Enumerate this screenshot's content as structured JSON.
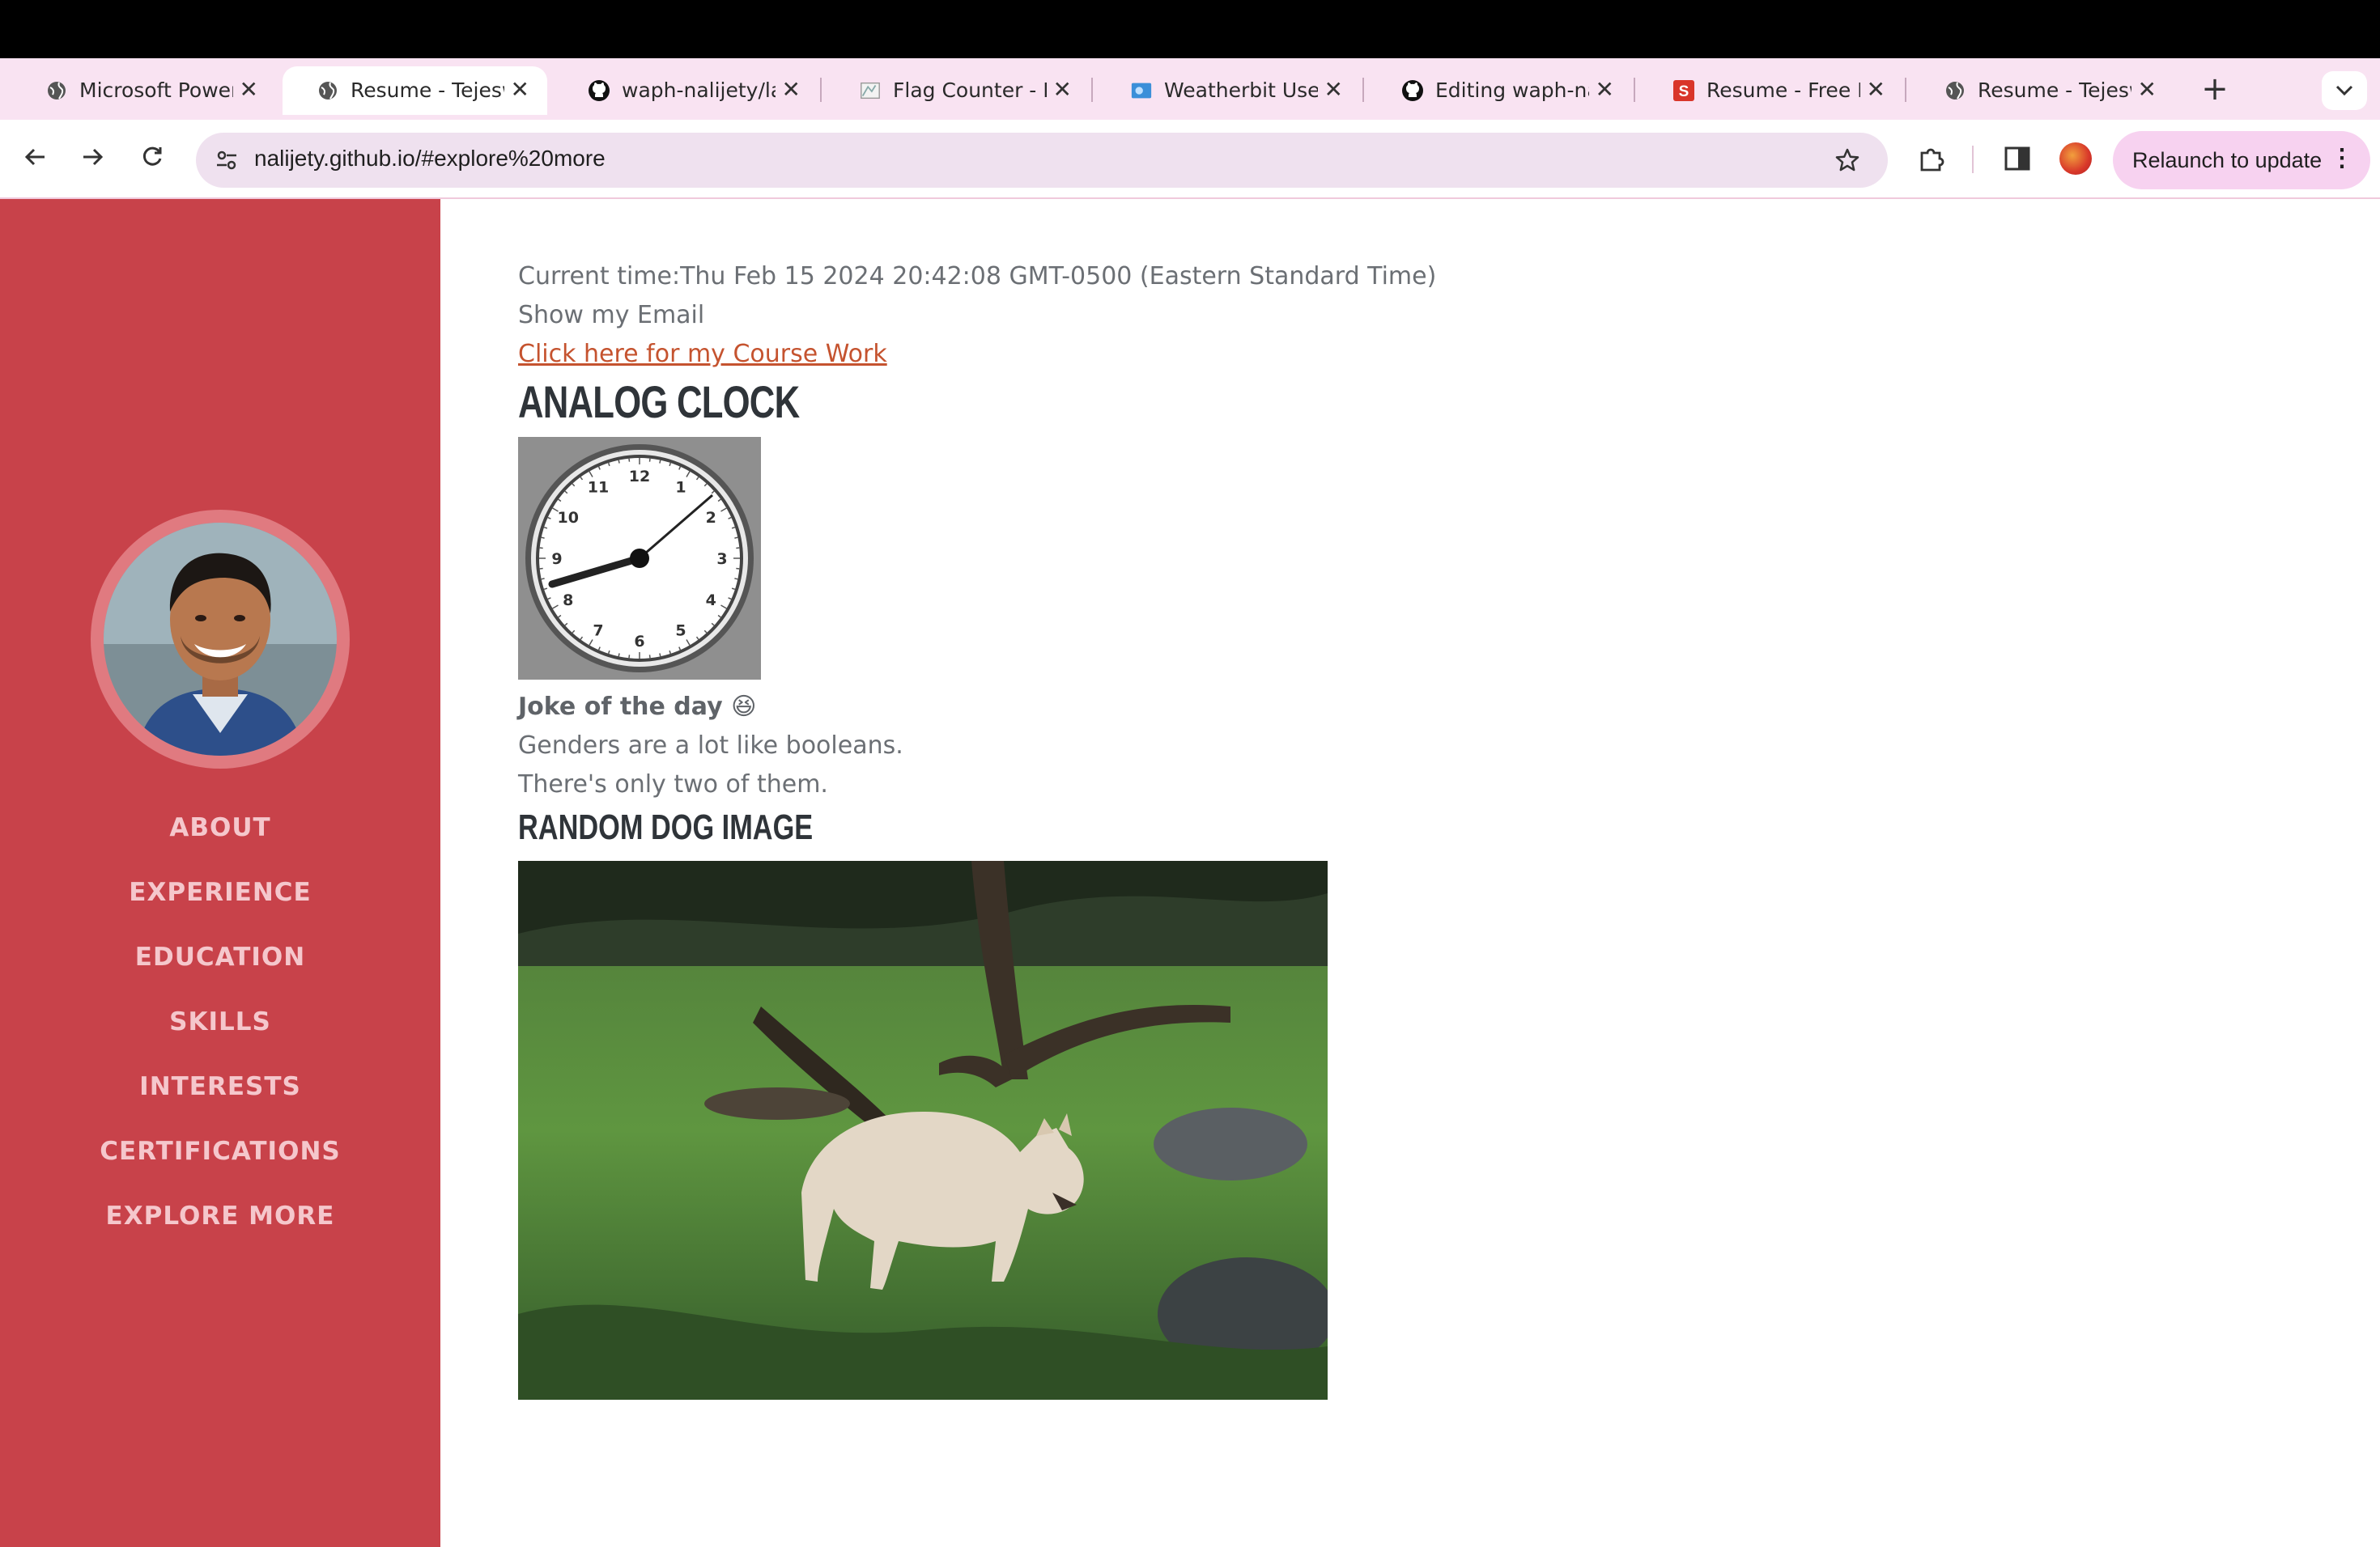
{
  "browser": {
    "tabs": [
      {
        "title": "Microsoft PowerPoint",
        "icon": "globe-icon",
        "active": false
      },
      {
        "title": "Resume - Tejeswar",
        "icon": "globe-icon",
        "active": true
      },
      {
        "title": "waph-nalijety/lab",
        "icon": "github-icon",
        "active": false
      },
      {
        "title": "Flag Counter - Free",
        "icon": "flag-counter-icon",
        "active": false
      },
      {
        "title": "Weatherbit User",
        "icon": "weatherbit-icon",
        "active": false
      },
      {
        "title": "Editing waph-nalijety",
        "icon": "github-icon",
        "active": false
      },
      {
        "title": "Resume - Free Resume",
        "icon": "resume-s-icon",
        "active": false
      },
      {
        "title": "Resume - Tejeswar",
        "icon": "globe-icon",
        "active": false
      }
    ],
    "new_tab": "+",
    "url": "nalijety.github.io/#explore%20more",
    "relaunch_label": "Relaunch to update",
    "accent": "#f7d2f0"
  },
  "sidebar": {
    "bg": "#c8424a",
    "nav": [
      "ABOUT",
      "EXPERIENCE",
      "EDUCATION",
      "SKILLS",
      "INTERESTS",
      "CERTIFICATIONS",
      "EXPLORE MORE"
    ]
  },
  "content": {
    "current_time": "Current time:Thu Feb 15 2024 20:42:08 GMT-0500 (Eastern Standard Time)",
    "show_email": "Show my Email",
    "course_link": "Click here for my Course Work",
    "clock_heading": "ANALOG CLOCK",
    "clock_numbers": [
      "12",
      "1",
      "2",
      "3",
      "4",
      "5",
      "6",
      "7",
      "8",
      "9",
      "10",
      "11"
    ],
    "joke_title": "Joke of the day 😆",
    "joke_line1": "Genders are a lot like booleans.",
    "joke_line2": "There's only two of them.",
    "dog_heading": "RANDOM DOG IMAGE"
  }
}
